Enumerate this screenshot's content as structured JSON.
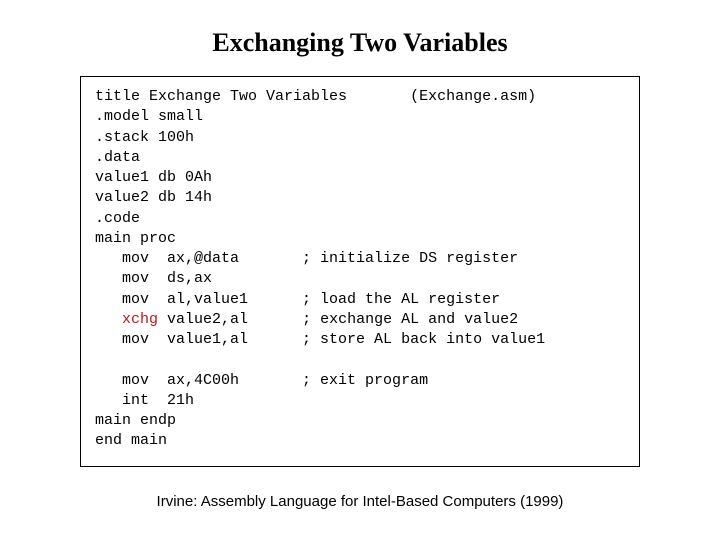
{
  "title": "Exchanging Two Variables",
  "code": {
    "l01a": "title Exchange Two Variables",
    "l01b": "(Exchange.asm)",
    "l02": ".model small",
    "l03": ".stack 100h",
    "l04": ".data",
    "l05": "value1 db 0Ah",
    "l06": "value2 db 14h",
    "l07": ".code",
    "l08": "main proc",
    "l09a": "   mov  ax,@data",
    "l09b": "; initialize DS register",
    "l10": "   mov  ds,ax",
    "l11a": "   mov  al,value1",
    "l11b": "; load the AL register",
    "l12ind": "   ",
    "l12kw": "xchg",
    "l12arg": " value2,al",
    "l12c": "; exchange AL and value2",
    "l13a": "   mov  value1,al",
    "l13b": "; store AL back into value1",
    "l14a": "   mov  ax,4C00h",
    "l14b": "; exit program",
    "l15": "   int  21h",
    "l16": "main endp",
    "l17": "end main"
  },
  "footer": "Irvine: Assembly Language for Intel-Based Computers (1999)"
}
